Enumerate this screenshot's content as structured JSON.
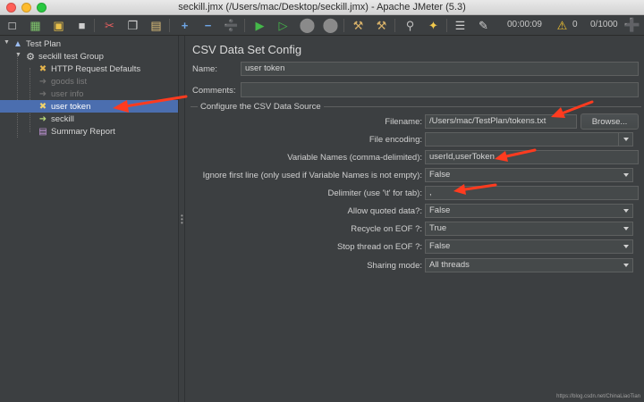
{
  "window": {
    "title": "seckill.jmx (/Users/mac/Desktop/seckill.jmx) - Apache JMeter (5.3)"
  },
  "toolbar": {
    "icons": [
      "new-icon",
      "templates-icon",
      "open-icon",
      "save-icon",
      "cut-icon",
      "copy-icon",
      "paste-icon",
      "expand-icon",
      "collapse-icon",
      "toggle-icon",
      "start-icon",
      "start-no-pause-icon",
      "stop-icon",
      "shutdown-icon",
      "clear-icon",
      "clear-all-icon",
      "search-icon",
      "reset-search-icon",
      "function-helper-icon",
      "help-icon"
    ],
    "elapsed_time": "00:00:09",
    "warning_count": "0",
    "threads_ratio": "0/1000"
  },
  "tree": {
    "items": [
      {
        "label": "Test Plan",
        "icon": "test-plan-icon"
      },
      {
        "label": "seckill test Group",
        "icon": "thread-group-icon"
      },
      {
        "label": "HTTP Request Defaults",
        "icon": "config-element-icon"
      },
      {
        "label": "goods list",
        "icon": "csv-config-icon"
      },
      {
        "label": "user info",
        "icon": "csv-config-icon"
      },
      {
        "label": "user token",
        "icon": "csv-config-icon"
      },
      {
        "label": "seckill",
        "icon": "http-sampler-icon"
      },
      {
        "label": "Summary Report",
        "icon": "listener-icon"
      }
    ],
    "selected": "user token"
  },
  "panel": {
    "title": "CSV Data Set Config",
    "name_label": "Name:",
    "name_value": "user token",
    "comments_label": "Comments:",
    "comments_value": "",
    "group_title": "Configure the CSV Data Source",
    "filename_label": "Filename:",
    "filename_value": "/Users/mac/TestPlan/tokens.txt",
    "browse_label": "Browse...",
    "encoding_label": "File encoding:",
    "encoding_value": "",
    "varnames_label": "Variable Names (comma-delimited):",
    "varnames_value": "userId,userToken",
    "ignore_label": "Ignore first line (only used if Variable Names is not empty):",
    "ignore_value": "False",
    "delimiter_label": "Delimiter (use '\\t' for tab):",
    "delimiter_value": ",",
    "quoted_label": "Allow quoted data?:",
    "quoted_value": "False",
    "recycle_label": "Recycle on EOF ?:",
    "recycle_value": "True",
    "stop_label": "Stop thread on EOF ?:",
    "stop_value": "False",
    "sharing_label": "Sharing mode:",
    "sharing_value": "All threads"
  },
  "watermark": "https://blog.csdn.net/ChinaLiaoTian",
  "colors": {
    "background": "#3c3f41",
    "selection": "#4b6eaf",
    "annotation_arrow": "#ff3b1f"
  }
}
